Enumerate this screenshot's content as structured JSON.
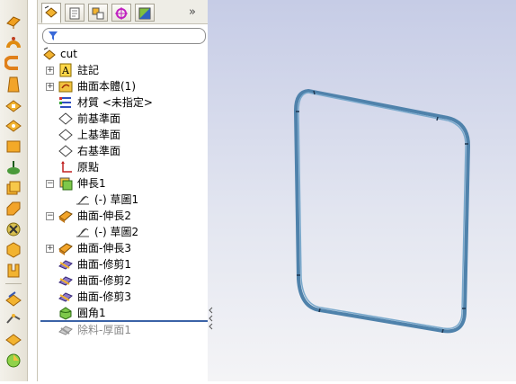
{
  "tree": {
    "root_label": "cut",
    "filter_placeholder": "",
    "items": [
      {
        "label": "註記",
        "expander": "+"
      },
      {
        "label": "曲面本體(1)",
        "expander": "+"
      },
      {
        "label": "材質 <未指定>",
        "expander": ""
      },
      {
        "label": "前基準面",
        "expander": ""
      },
      {
        "label": "上基準面",
        "expander": ""
      },
      {
        "label": "右基準面",
        "expander": ""
      },
      {
        "label": "原點",
        "expander": ""
      },
      {
        "label": "伸長1",
        "expander": "−"
      },
      {
        "label": "(-) 草圖1",
        "expander": ""
      },
      {
        "label": "曲面-伸長2",
        "expander": "−"
      },
      {
        "label": "(-) 草圖2",
        "expander": ""
      },
      {
        "label": "曲面-伸長3",
        "expander": "+"
      },
      {
        "label": "曲面-修剪1",
        "expander": ""
      },
      {
        "label": "曲面-修剪2",
        "expander": ""
      },
      {
        "label": "曲面-修剪3",
        "expander": ""
      },
      {
        "label": "圓角1",
        "expander": ""
      },
      {
        "label": "除料-厚面1",
        "expander": ""
      }
    ]
  },
  "tabs": [
    {
      "name": "feature-manager"
    },
    {
      "name": "property-manager"
    },
    {
      "name": "configuration-manager"
    },
    {
      "name": "dimxpert-manager"
    },
    {
      "name": "display-manager"
    }
  ],
  "tab_more_symbol": "»",
  "colors": {
    "rollback_bar": "#3b63a7",
    "model_edge": "#3f6f96",
    "model_face": "#5c8fb5",
    "viewport_top": "#c6cce6",
    "viewport_bottom": "#f4f4f6"
  }
}
